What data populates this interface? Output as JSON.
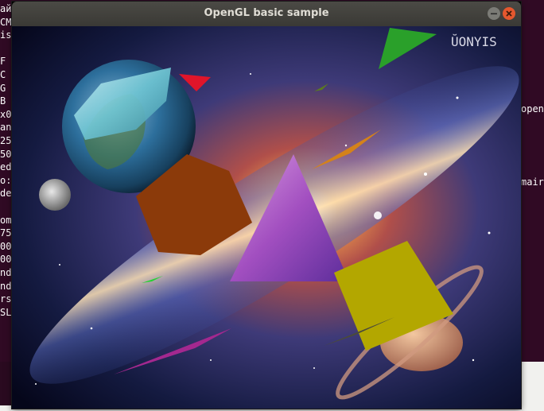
{
  "window": {
    "title": "OpenGL basic sample"
  },
  "watermark": "Ŭ",
  "terminal": {
    "left_lines": [
      "айл",
      "CM",
      "is",
      "",
      "F",
      "C",
      "G",
      "B",
      "x0",
      "an",
      "25",
      "50",
      "ed",
      "o:",
      "de",
      "",
      "om",
      "75",
      "00",
      "00",
      "nd",
      "nd",
      "rs",
      "SL"
    ],
    "right_lines": [
      "openg",
      "",
      "",
      "",
      "mair"
    ]
  },
  "colors": {
    "planet_ocean": "#2d6f9c",
    "brown_cube": "#8b3a0a",
    "yellow_cube": "#b3a700",
    "green_triangle": "#2aa02a",
    "red_triangle": "#e0152a",
    "orange_triangle": "#d4821a",
    "magenta_triangle": "#a4288f",
    "pyramid": "#a24fc0"
  }
}
